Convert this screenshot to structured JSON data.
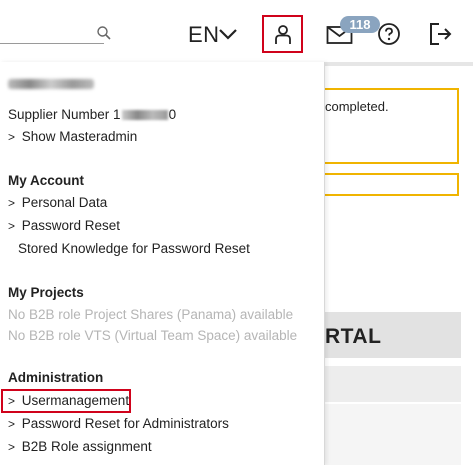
{
  "header": {
    "language": "EN",
    "mail_count": "118",
    "icons": [
      "search-icon",
      "chevron-down-icon",
      "user-icon",
      "mail-icon",
      "help-icon",
      "logout-icon"
    ]
  },
  "background": {
    "notice_text": "completed.",
    "band_title": "RTAL"
  },
  "menu": {
    "supplier_label": "Supplier Number 1",
    "supplier_suffix": "0",
    "show_masteradmin": "Show Masteradmin",
    "my_account": {
      "title": "My Account",
      "items": [
        "Personal Data",
        "Password Reset",
        "Stored Knowledge for Password Reset"
      ]
    },
    "my_projects": {
      "title": "My Projects",
      "items": [
        "No B2B role Project Shares (Panama) available",
        "No B2B role VTS (Virtual Team Space) available"
      ]
    },
    "administration": {
      "title": "Administration",
      "items": [
        "Usermanagement",
        "Password Reset for Administrators",
        "B2B Role assignment"
      ]
    }
  },
  "colors": {
    "highlight_red": "#d0021b",
    "warning_border": "#f0b400",
    "badge_bg": "#8aa4bf",
    "disabled_text": "#b5b5b5"
  }
}
